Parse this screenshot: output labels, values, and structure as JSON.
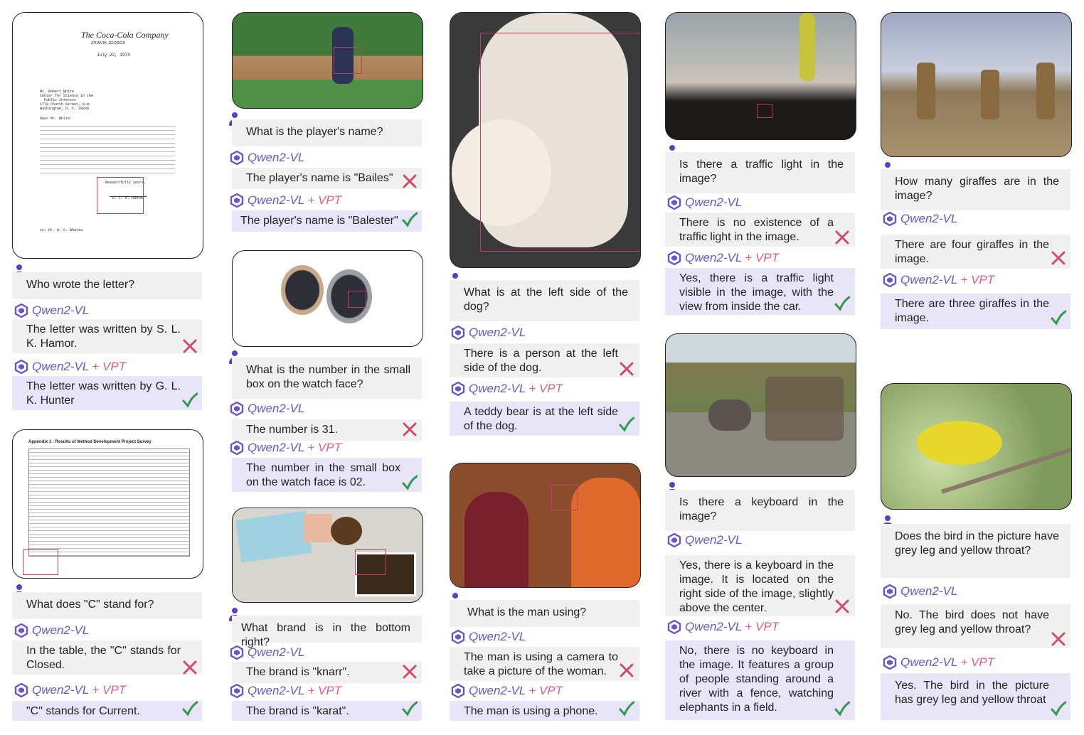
{
  "colors": {
    "accent": "#6a55c8",
    "vpt": "#e05d87",
    "wrong": "#cf4b6e",
    "right": "#2f9b4f",
    "question_bg": "#f0f0f0",
    "vpt_bg": "#e8e5f8"
  },
  "icons": {
    "user": "user-icon",
    "model": "qwen-logo-icon",
    "wrong": "cross-icon",
    "right": "check-icon"
  },
  "model_label": "Qwen2-VL",
  "vpt_suffix": "+ VPT",
  "letter": {
    "company": "The Coca-Cola Company",
    "city": "ATLANTA, GEORGIA",
    "date": "July 22, 1974",
    "address": "Mr. Robert White\nCenter for Science in the\n  Public Interest\n1779 Church Street, N.W.\nWashington, D. C. 20036",
    "salutation": "Dear Mr. White:",
    "closing": "Respectfully yours,",
    "signer": "G. L. K. Hunter",
    "cc": "cc:  Dr. O. S. Bhatia"
  },
  "table_doc": {
    "title": "Appendix 1 : Results of Method Development Project Survey"
  },
  "items": {
    "letter": {
      "q": "Who wrote the letter?",
      "a": "The letter was written by S. L. K. Hamor.",
      "v": "The letter was written by G. L. K. Hunter"
    },
    "table": {
      "q": "What does \"C\" stand for?",
      "a": "In the table, the \"C\" stands for Closed.",
      "v": "\"C\" stands for Current."
    },
    "player": {
      "q": "What is the player's name?",
      "a": "The player's  name is \"Bailes\"",
      "v": "The player's name is \"Balester\""
    },
    "watch": {
      "q": "What is the number in the small box on the watch face?",
      "a": "The number is 31.",
      "v": "The number in the small box on the watch face is 02."
    },
    "brand": {
      "q": "What brand is in the bottom right?",
      "a": "The brand is \"knarr\".",
      "v": "The brand is \"karat\"."
    },
    "teddy": {
      "q": "What is at the left side of the dog?",
      "a": "There is a person at the left side of the dog.",
      "v": "A teddy bear is at the left side of the dog."
    },
    "man": {
      "q": "What is the man using?",
      "a": "The man is using a camera to take a picture of the woman.",
      "v": "The man is using a phone."
    },
    "traffic": {
      "q": "Is there a traffic light in the image?",
      "a": "There is no existence of a traffic light in the image.",
      "v": "Yes, there is a traffic light visible in the image, with the view from inside the car."
    },
    "keyboard": {
      "q": "Is there a keyboard in the image?",
      "a": "Yes, there is a keyboard in the image. It is located on the right side of the image, slightly above the center.",
      "v": "No, there is no keyboard in the image. It features a group of people standing around a river with a fence, watching elephants in a field."
    },
    "giraffe": {
      "q": "How many giraffes are in the image?",
      "a": "There are four giraffes in the image.",
      "v": "There are three giraffes in the image."
    },
    "bird": {
      "q": "Does the bird in the picture have grey leg and yellow throat?",
      "a": "No. The bird does not have grey leg and yellow throat?",
      "v": "Yes. The bird in the picture has grey leg and yellow throat"
    }
  }
}
